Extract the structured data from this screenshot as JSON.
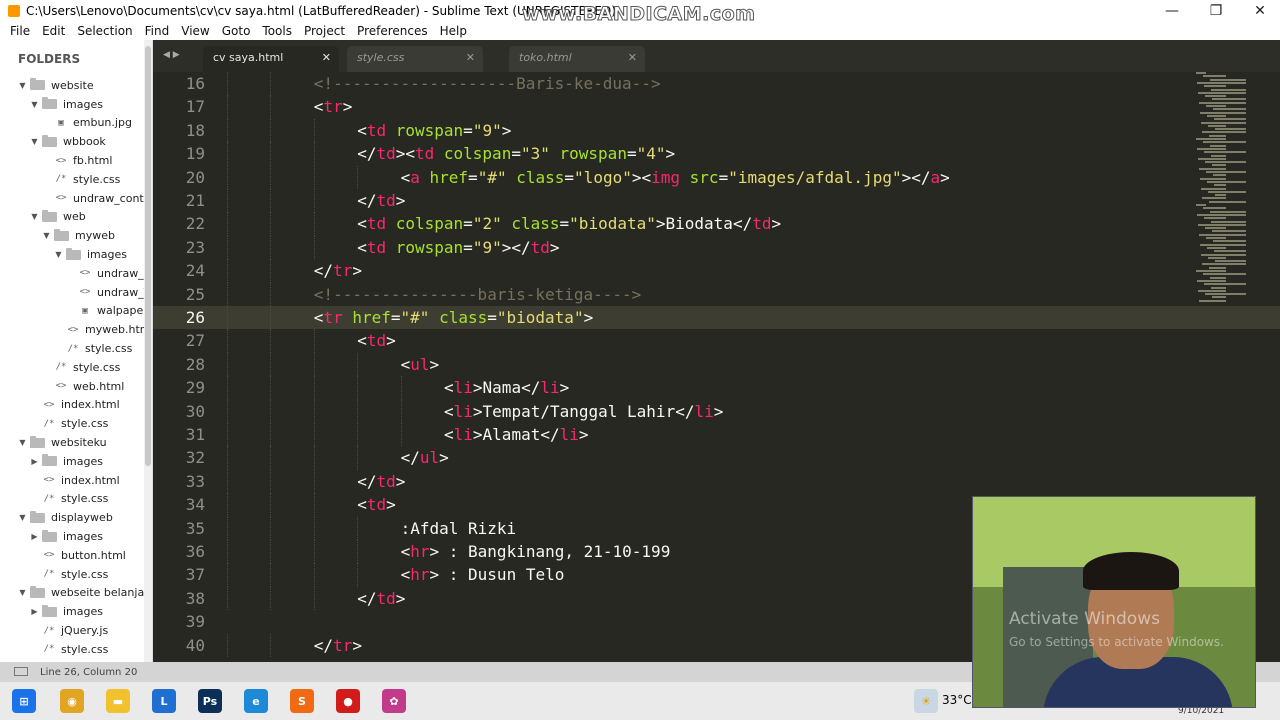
{
  "window": {
    "title": "C:\\Users\\Lenovo\\Documents\\cv\\cv saya.html (LatBufferedReader) - Sublime Text (UNREGISTERED)",
    "watermark": "www.BANDICAM.com",
    "minimize": "—",
    "maximize": "❐",
    "close": "✕"
  },
  "menu": [
    "File",
    "Edit",
    "Selection",
    "Find",
    "View",
    "Goto",
    "Tools",
    "Project",
    "Preferences",
    "Help"
  ],
  "sidebar": {
    "header": "FOLDERS",
    "items": [
      {
        "label": "website",
        "type": "folder",
        "depth": 0,
        "open": true
      },
      {
        "label": "images",
        "type": "folder",
        "depth": 1,
        "open": true
      },
      {
        "label": "embun.jpg",
        "type": "image",
        "depth": 2
      },
      {
        "label": "wbbook",
        "type": "folder",
        "depth": 1,
        "open": true
      },
      {
        "label": "fb.html",
        "type": "code",
        "depth": 2
      },
      {
        "label": "style.css",
        "type": "css",
        "depth": 2
      },
      {
        "label": "undraw_conte",
        "type": "code",
        "depth": 2
      },
      {
        "label": "web",
        "type": "folder",
        "depth": 1,
        "open": true
      },
      {
        "label": "myweb",
        "type": "folder",
        "depth": 2,
        "open": true
      },
      {
        "label": "images",
        "type": "folder",
        "depth": 3,
        "open": true
      },
      {
        "label": "undraw_c",
        "type": "code",
        "depth": 4
      },
      {
        "label": "undraw_\\",
        "type": "code",
        "depth": 4
      },
      {
        "label": "walpaper",
        "type": "image",
        "depth": 4
      },
      {
        "label": "myweb.htm",
        "type": "code",
        "depth": 3
      },
      {
        "label": "style.css",
        "type": "css",
        "depth": 3
      },
      {
        "label": "style.css",
        "type": "css",
        "depth": 2
      },
      {
        "label": "web.html",
        "type": "code",
        "depth": 2
      },
      {
        "label": "index.html",
        "type": "code",
        "depth": 1
      },
      {
        "label": "style.css",
        "type": "css",
        "depth": 1
      },
      {
        "label": "websiteku",
        "type": "folder",
        "depth": 0,
        "open": true
      },
      {
        "label": "images",
        "type": "folder",
        "depth": 1,
        "open": false
      },
      {
        "label": "index.html",
        "type": "code",
        "depth": 1
      },
      {
        "label": "style.css",
        "type": "css",
        "depth": 1
      },
      {
        "label": "displayweb",
        "type": "folder",
        "depth": 0,
        "open": true
      },
      {
        "label": "images",
        "type": "folder",
        "depth": 1,
        "open": false
      },
      {
        "label": "button.html",
        "type": "code",
        "depth": 1
      },
      {
        "label": "style.css",
        "type": "css",
        "depth": 1
      },
      {
        "label": "webseite belanja",
        "type": "folder",
        "depth": 0,
        "open": true
      },
      {
        "label": "images",
        "type": "folder",
        "depth": 1,
        "open": false
      },
      {
        "label": "jQuery.js",
        "type": "css",
        "depth": 1
      },
      {
        "label": "style.css",
        "type": "css",
        "depth": 1
      }
    ]
  },
  "tabs": [
    {
      "label": "cv saya.html",
      "active": true
    },
    {
      "label": "style.css",
      "active": false
    },
    {
      "label": "toko.html",
      "active": false
    }
  ],
  "editor": {
    "current_line": 26,
    "lines": [
      {
        "n": 16,
        "indent": 2,
        "tokens": [
          [
            "c",
            "<!-------------------Baris-ke-dua-->"
          ]
        ]
      },
      {
        "n": 17,
        "indent": 2,
        "tokens": [
          [
            "p",
            "<"
          ],
          [
            "t",
            "tr"
          ],
          [
            "p",
            ">"
          ]
        ]
      },
      {
        "n": 18,
        "indent": 3,
        "tokens": [
          [
            "p",
            "<"
          ],
          [
            "t",
            "td"
          ],
          [
            "p",
            " "
          ],
          [
            "a",
            "rowspan"
          ],
          [
            "p",
            "="
          ],
          [
            "s",
            "\"9\""
          ],
          [
            "p",
            ">"
          ]
        ]
      },
      {
        "n": 19,
        "indent": 3,
        "tokens": [
          [
            "p",
            "</"
          ],
          [
            "t",
            "td"
          ],
          [
            "p",
            "><"
          ],
          [
            "t",
            "td"
          ],
          [
            "p",
            " "
          ],
          [
            "a",
            "colspan"
          ],
          [
            "p",
            "="
          ],
          [
            "s",
            "\"3\""
          ],
          [
            "p",
            " "
          ],
          [
            "a",
            "rowspan"
          ],
          [
            "p",
            "="
          ],
          [
            "s",
            "\"4\""
          ],
          [
            "p",
            ">"
          ]
        ]
      },
      {
        "n": 20,
        "indent": 4,
        "tokens": [
          [
            "p",
            "<"
          ],
          [
            "t",
            "a"
          ],
          [
            "p",
            " "
          ],
          [
            "a",
            "href"
          ],
          [
            "p",
            "="
          ],
          [
            "s",
            "\"#\""
          ],
          [
            "p",
            " "
          ],
          [
            "a",
            "class"
          ],
          [
            "p",
            "="
          ],
          [
            "s",
            "\"logo\""
          ],
          [
            "p",
            "><"
          ],
          [
            "t",
            "img"
          ],
          [
            "p",
            " "
          ],
          [
            "a",
            "src"
          ],
          [
            "p",
            "="
          ],
          [
            "s",
            "\"images/afdal.jpg\""
          ],
          [
            "p",
            "></"
          ],
          [
            "t",
            "a"
          ],
          [
            "p",
            ">"
          ]
        ]
      },
      {
        "n": 21,
        "indent": 3,
        "tokens": [
          [
            "p",
            "</"
          ],
          [
            "t",
            "td"
          ],
          [
            "p",
            ">"
          ]
        ]
      },
      {
        "n": 22,
        "indent": 3,
        "tokens": [
          [
            "p",
            "<"
          ],
          [
            "t",
            "td"
          ],
          [
            "p",
            " "
          ],
          [
            "a",
            "colspan"
          ],
          [
            "p",
            "="
          ],
          [
            "s",
            "\"2\""
          ],
          [
            "p",
            " "
          ],
          [
            "a",
            "class"
          ],
          [
            "p",
            "="
          ],
          [
            "s",
            "\"biodata\""
          ],
          [
            "p",
            ">Biodata</"
          ],
          [
            "t",
            "td"
          ],
          [
            "p",
            ">"
          ]
        ]
      },
      {
        "n": 23,
        "indent": 3,
        "tokens": [
          [
            "p",
            "<"
          ],
          [
            "t",
            "td"
          ],
          [
            "p",
            " "
          ],
          [
            "a",
            "rowspan"
          ],
          [
            "p",
            "="
          ],
          [
            "s",
            "\"9\""
          ],
          [
            "p",
            "></"
          ],
          [
            "t",
            "td"
          ],
          [
            "p",
            ">"
          ]
        ]
      },
      {
        "n": 24,
        "indent": 2,
        "tokens": [
          [
            "p",
            "</"
          ],
          [
            "t",
            "tr"
          ],
          [
            "p",
            ">"
          ]
        ]
      },
      {
        "n": 25,
        "indent": 2,
        "tokens": [
          [
            "c",
            "<!---------------baris-ketiga---->"
          ]
        ]
      },
      {
        "n": 26,
        "indent": 2,
        "tokens": [
          [
            "p",
            "<"
          ],
          [
            "t",
            "tr"
          ],
          [
            "p",
            " "
          ],
          [
            "a",
            "href"
          ],
          [
            "p",
            "="
          ],
          [
            "s",
            "\"#\""
          ],
          [
            "p",
            " "
          ],
          [
            "a",
            "class"
          ],
          [
            "p",
            "="
          ],
          [
            "s",
            "\"biodata\""
          ],
          [
            "p",
            ">"
          ]
        ]
      },
      {
        "n": 27,
        "indent": 3,
        "tokens": [
          [
            "p",
            "<"
          ],
          [
            "t",
            "td"
          ],
          [
            "p",
            ">"
          ]
        ]
      },
      {
        "n": 28,
        "indent": 4,
        "tokens": [
          [
            "p",
            "<"
          ],
          [
            "t",
            "ul"
          ],
          [
            "p",
            ">"
          ]
        ]
      },
      {
        "n": 29,
        "indent": 5,
        "tokens": [
          [
            "p",
            "<"
          ],
          [
            "t",
            "li"
          ],
          [
            "p",
            ">Nama</"
          ],
          [
            "t",
            "li"
          ],
          [
            "p",
            ">"
          ]
        ]
      },
      {
        "n": 30,
        "indent": 5,
        "tokens": [
          [
            "p",
            "<"
          ],
          [
            "t",
            "li"
          ],
          [
            "p",
            ">Tempat/Tanggal Lahir</"
          ],
          [
            "t",
            "li"
          ],
          [
            "p",
            ">"
          ]
        ]
      },
      {
        "n": 31,
        "indent": 5,
        "tokens": [
          [
            "p",
            "<"
          ],
          [
            "t",
            "li"
          ],
          [
            "p",
            ">Alamat</"
          ],
          [
            "t",
            "li"
          ],
          [
            "p",
            ">"
          ]
        ]
      },
      {
        "n": 32,
        "indent": 4,
        "tokens": [
          [
            "p",
            "</"
          ],
          [
            "t",
            "ul"
          ],
          [
            "p",
            ">"
          ]
        ]
      },
      {
        "n": 33,
        "indent": 3,
        "tokens": [
          [
            "p",
            "</"
          ],
          [
            "t",
            "td"
          ],
          [
            "p",
            ">"
          ]
        ]
      },
      {
        "n": 34,
        "indent": 3,
        "tokens": [
          [
            "p",
            "<"
          ],
          [
            "t",
            "td"
          ],
          [
            "p",
            ">"
          ]
        ]
      },
      {
        "n": 35,
        "indent": 4,
        "tokens": [
          [
            "p",
            ":Afdal Rizki"
          ]
        ]
      },
      {
        "n": 36,
        "indent": 4,
        "tokens": [
          [
            "p",
            "<"
          ],
          [
            "t",
            "hr"
          ],
          [
            "p",
            "> : Bangkinang, 21-10-199"
          ]
        ]
      },
      {
        "n": 37,
        "indent": 4,
        "tokens": [
          [
            "p",
            "<"
          ],
          [
            "t",
            "hr"
          ],
          [
            "p",
            "> : Dusun Telo"
          ]
        ]
      },
      {
        "n": 38,
        "indent": 3,
        "tokens": [
          [
            "p",
            "</"
          ],
          [
            "t",
            "td"
          ],
          [
            "p",
            ">"
          ]
        ]
      },
      {
        "n": 39,
        "indent": 0,
        "tokens": []
      },
      {
        "n": 40,
        "indent": 2,
        "tokens": [
          [
            "p",
            "</"
          ],
          [
            "t",
            "tr"
          ],
          [
            "p",
            ">"
          ]
        ]
      }
    ]
  },
  "status": "Line 26, Column 20",
  "taskbar": {
    "apps": [
      "windows-start",
      "chrome",
      "file-explorer",
      "l-app",
      "photoshop",
      "edge",
      "sublime-text",
      "bandicam",
      "app-8"
    ],
    "temperature": "33°C",
    "date": "9/10/2021"
  },
  "overlay": {
    "activate_title": "Activate Windows",
    "activate_sub": "Go to Settings to activate Windows."
  },
  "colors": {
    "editor_bg": "#272822",
    "tag": "#f92672",
    "attr": "#a6e22e",
    "string": "#e6db74",
    "comment": "#75715e"
  }
}
